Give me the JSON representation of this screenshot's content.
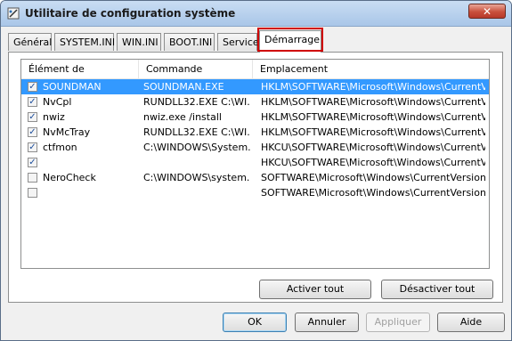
{
  "window": {
    "title": "Utilitaire de configuration système",
    "close_glyph": "✕"
  },
  "tabs": [
    {
      "label": "Général"
    },
    {
      "label": "SYSTEM.INI"
    },
    {
      "label": "WIN.INI"
    },
    {
      "label": "BOOT.INI"
    },
    {
      "label": "Services"
    },
    {
      "label": "Démarrage"
    }
  ],
  "active_tab": "Démarrage",
  "table": {
    "columns": [
      "Élément de démarrage",
      "Commande",
      "Emplacement"
    ],
    "rows": [
      {
        "checked": true,
        "item": "SOUNDMAN",
        "command": "SOUNDMAN.EXE",
        "location": "HKLM\\SOFTWARE\\Microsoft\\Windows\\CurrentVer..."
      },
      {
        "checked": true,
        "item": "NvCpl",
        "command": "RUNDLL32.EXE C:\\WI...",
        "location": "HKLM\\SOFTWARE\\Microsoft\\Windows\\CurrentVer..."
      },
      {
        "checked": true,
        "item": "nwiz",
        "command": "nwiz.exe /install",
        "location": "HKLM\\SOFTWARE\\Microsoft\\Windows\\CurrentVer..."
      },
      {
        "checked": true,
        "item": "NvMcTray",
        "command": "RUNDLL32.EXE C:\\WI...",
        "location": "HKLM\\SOFTWARE\\Microsoft\\Windows\\CurrentVer..."
      },
      {
        "checked": true,
        "item": "ctfmon",
        "command": "C:\\WINDOWS\\System...",
        "location": "HKCU\\SOFTWARE\\Microsoft\\Windows\\CurrentVer..."
      },
      {
        "checked": true,
        "item": "",
        "command": "",
        "location": "HKCU\\SOFTWARE\\Microsoft\\Windows\\CurrentVer..."
      },
      {
        "checked": false,
        "item": "NeroCheck",
        "command": "C:\\WINDOWS\\system...",
        "location": "SOFTWARE\\Microsoft\\Windows\\CurrentVersion\\Run"
      },
      {
        "checked": false,
        "item": "",
        "command": "",
        "location": "SOFTWARE\\Microsoft\\Windows\\CurrentVersion\\Run"
      }
    ]
  },
  "buttons": {
    "enable_all": "Activer tout",
    "disable_all": "Désactiver tout",
    "ok": "OK",
    "cancel": "Annuler",
    "apply": "Appliquer",
    "help": "Aide"
  },
  "colors": {
    "selection": "#3399ff",
    "tab_highlight": "#d00000"
  }
}
